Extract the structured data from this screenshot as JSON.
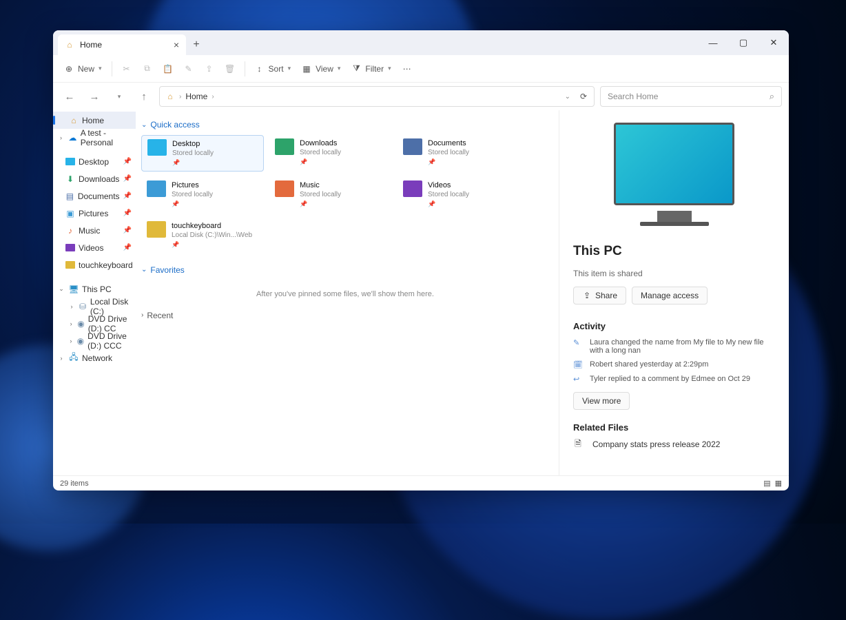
{
  "tab": {
    "title": "Home"
  },
  "toolbar": {
    "new": "New",
    "sort": "Sort",
    "view": "View",
    "filter": "Filter"
  },
  "breadcrumb": {
    "root": "Home"
  },
  "search": {
    "placeholder": "Search Home"
  },
  "nav": {
    "home": "Home",
    "personal": "A test - Personal",
    "desktop": "Desktop",
    "downloads": "Downloads",
    "documents": "Documents",
    "pictures": "Pictures",
    "music": "Music",
    "videos": "Videos",
    "touchkeyboard": "touchkeyboard",
    "thispc": "This PC",
    "localdisk": "Local Disk (C:)",
    "dvd1": "DVD Drive (D:) CC",
    "dvd2": "DVD Drive (D:) CCC",
    "network": "Network"
  },
  "sections": {
    "quick": "Quick access",
    "favorites": "Favorites",
    "favmsg": "After you've pinned some files, we'll show them here.",
    "recent": "Recent"
  },
  "tiles": [
    {
      "name": "Desktop",
      "loc": "Stored locally",
      "color": "#27b3e8"
    },
    {
      "name": "Downloads",
      "loc": "Stored locally",
      "color": "#2da36a"
    },
    {
      "name": "Documents",
      "loc": "Stored locally",
      "color": "#4d6fa8"
    },
    {
      "name": "Pictures",
      "loc": "Stored locally",
      "color": "#3c9bd6"
    },
    {
      "name": "Music",
      "loc": "Stored locally",
      "color": "#e36a3d"
    },
    {
      "name": "Videos",
      "loc": "Stored locally",
      "color": "#7a3dbb"
    },
    {
      "name": "touchkeyboard",
      "loc": "Local Disk (C:)\\Win...\\Web",
      "color": "#e0b93a"
    }
  ],
  "details": {
    "title": "This PC",
    "shared": "This item is shared",
    "share": "Share",
    "manage": "Manage access",
    "activityTitle": "Activity",
    "activity": [
      "Laura changed the name from My file to My new file with a long nan",
      "Robert shared yesterday at 2:29pm",
      "Tyler replied to a comment by Edmee on Oct 29"
    ],
    "viewmore": "View more",
    "relatedTitle": "Related Files",
    "related": "Company stats press release 2022"
  },
  "status": {
    "items": "29 items"
  }
}
